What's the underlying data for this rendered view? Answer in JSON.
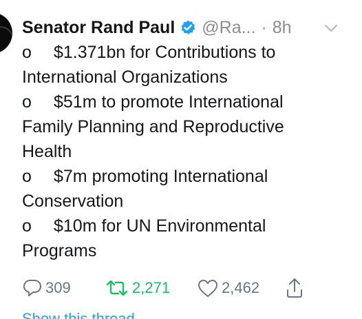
{
  "tweet": {
    "author_name": "Senator Rand Paul",
    "handle": "@Ra...",
    "separator": "·",
    "time": "8h",
    "icons": {
      "verified": "verified-badge-icon",
      "caret": "chevron-down-icon",
      "reply": "reply-icon",
      "retweet": "retweet-icon",
      "like": "heart-icon",
      "share": "share-icon"
    },
    "lines": [
      {
        "bullet": "o",
        "text": "$1.371bn for Contributions to"
      },
      {
        "bullet": "",
        "text": "International Organizations"
      },
      {
        "bullet": "o",
        "text": "$51m to promote International"
      },
      {
        "bullet": "",
        "text": "Family Planning and Reproductive"
      },
      {
        "bullet": "",
        "text": "Health"
      },
      {
        "bullet": "o",
        "text": "$7m promoting International"
      },
      {
        "bullet": "",
        "text": "Conservation"
      },
      {
        "bullet": "o",
        "text": "$10m for UN Environmental"
      },
      {
        "bullet": "",
        "text": "Programs"
      }
    ],
    "stats": {
      "replies": "309",
      "retweets": "2,271",
      "likes": "2,462"
    },
    "show_thread_label": "Show this thread"
  },
  "colors": {
    "text": "#14171a",
    "muted": "#8a8d91",
    "verified_blue": "#1da1f2",
    "retweet_green": "#17bf63",
    "action_gray": "#657786"
  }
}
